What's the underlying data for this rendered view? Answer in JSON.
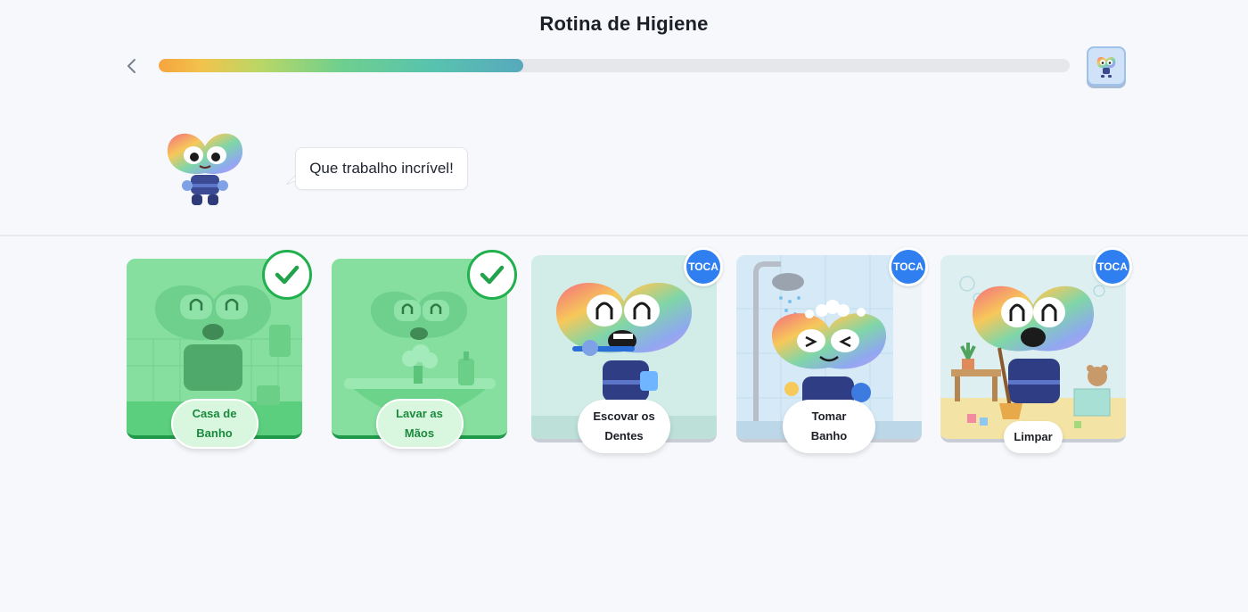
{
  "header": {
    "title": "Rotina de Higiene",
    "progress_fraction": 0.4
  },
  "mascot": {
    "speech": "Que trabalho incrível!"
  },
  "cards": [
    {
      "label_line1": "Casa de",
      "label_line2": "Banho",
      "status": "completed",
      "icon": "check-icon"
    },
    {
      "label_line1": "Lavar as",
      "label_line2": "Mãos",
      "status": "completed",
      "icon": "check-icon"
    },
    {
      "label_line1": "Escovar os",
      "label_line2": "Dentes",
      "status": "pending",
      "badge": "TOCA"
    },
    {
      "label_line1": "Tomar",
      "label_line2": "Banho",
      "status": "pending",
      "badge": "TOCA"
    },
    {
      "label_line1": "Limpar",
      "label_line2": "",
      "status": "pending",
      "badge": "TOCA"
    }
  ],
  "colors": {
    "done_green": "#7ede9b",
    "check_green": "#22b04f",
    "badge_blue": "#2f7ff0",
    "progress_start": "#f6a43e",
    "progress_end": "#57a9bd"
  }
}
